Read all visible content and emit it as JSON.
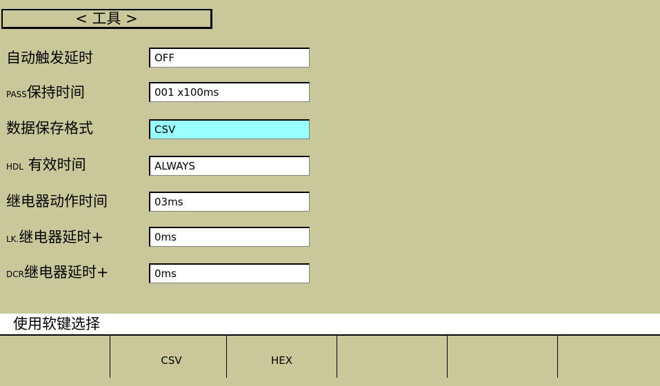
{
  "header": {
    "title": "< 工具 >"
  },
  "fields": [
    {
      "label": "自动触发延时",
      "value": "OFF"
    },
    {
      "label": "PASS保持时间",
      "value": "001 x100ms"
    },
    {
      "label": "数据保存格式",
      "value": "CSV",
      "selected": true
    },
    {
      "label": "HDL 有效时间",
      "value": "ALWAYS"
    },
    {
      "label": "继电器动作时间",
      "value": "03ms"
    },
    {
      "label": "LK.继电器延时+",
      "value": "0ms"
    },
    {
      "label": "DCR继电器延时+",
      "value": "0ms"
    }
  ],
  "hint": "使用软键选择",
  "softkeys": [
    "",
    "CSV",
    "HEX",
    "",
    "",
    ""
  ],
  "colors": {
    "background": "#c8c89a",
    "selected_field": "#99ffff",
    "field": "#ffffff",
    "hint_bar": "#ffffff"
  }
}
